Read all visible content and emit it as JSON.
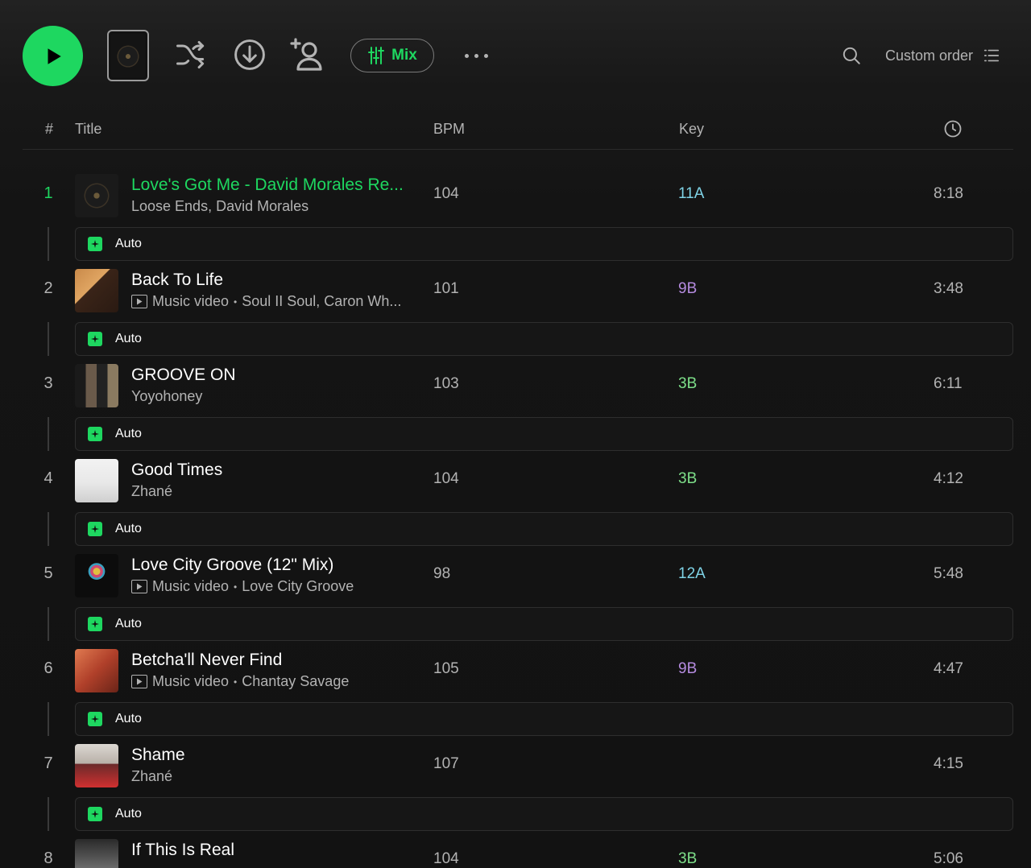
{
  "toolbar": {
    "mix_label": "Mix",
    "custom_order_label": "Custom order"
  },
  "header": {
    "num": "#",
    "title": "Title",
    "bpm": "BPM",
    "key": "Key"
  },
  "colors": {
    "accent": "#1ed760",
    "key_cyan": "#7fd3e6",
    "key_purple": "#b58be0",
    "key_green": "#7ee08a"
  },
  "tracks": [
    {
      "num": "1",
      "title": "Love's Got Me - David Morales Re...",
      "artists": "Loose Ends, David Morales",
      "music_video": false,
      "bpm": "104",
      "key": "11A",
      "key_color": "#7fd3e6",
      "duration": "8:18",
      "playing": true,
      "transition": "Auto"
    },
    {
      "num": "2",
      "title": "Back To Life",
      "artists": "Soul II Soul, Caron Wh...",
      "music_video": true,
      "music_video_label": "Music video",
      "bpm": "101",
      "key": "9B",
      "key_color": "#b58be0",
      "duration": "3:48",
      "playing": false,
      "transition": "Auto"
    },
    {
      "num": "3",
      "title": "GROOVE ON",
      "artists": "Yoyohoney",
      "music_video": false,
      "bpm": "103",
      "key": "3B",
      "key_color": "#7ee08a",
      "duration": "6:11",
      "playing": false,
      "transition": "Auto"
    },
    {
      "num": "4",
      "title": "Good Times",
      "artists": "Zhané",
      "music_video": false,
      "bpm": "104",
      "key": "3B",
      "key_color": "#7ee08a",
      "duration": "4:12",
      "playing": false,
      "transition": "Auto"
    },
    {
      "num": "5",
      "title": "Love City Groove (12\" Mix)",
      "artists": "Love City Groove",
      "music_video": true,
      "music_video_label": "Music video",
      "bpm": "98",
      "key": "12A",
      "key_color": "#7fd3e6",
      "duration": "5:48",
      "playing": false,
      "transition": "Auto"
    },
    {
      "num": "6",
      "title": "Betcha'll Never Find",
      "artists": "Chantay Savage",
      "music_video": true,
      "music_video_label": "Music video",
      "bpm": "105",
      "key": "9B",
      "key_color": "#b58be0",
      "duration": "4:47",
      "playing": false,
      "transition": "Auto"
    },
    {
      "num": "7",
      "title": "Shame",
      "artists": "Zhané",
      "music_video": false,
      "bpm": "107",
      "key": "",
      "key_color": "#7ee08a",
      "duration": "4:15",
      "playing": false,
      "transition": "Auto"
    },
    {
      "num": "8",
      "title": "If This Is Real",
      "artists": "",
      "music_video": false,
      "bpm": "104",
      "key": "3B",
      "key_color": "#7ee08a",
      "duration": "5:06",
      "playing": false,
      "transition": ""
    }
  ]
}
